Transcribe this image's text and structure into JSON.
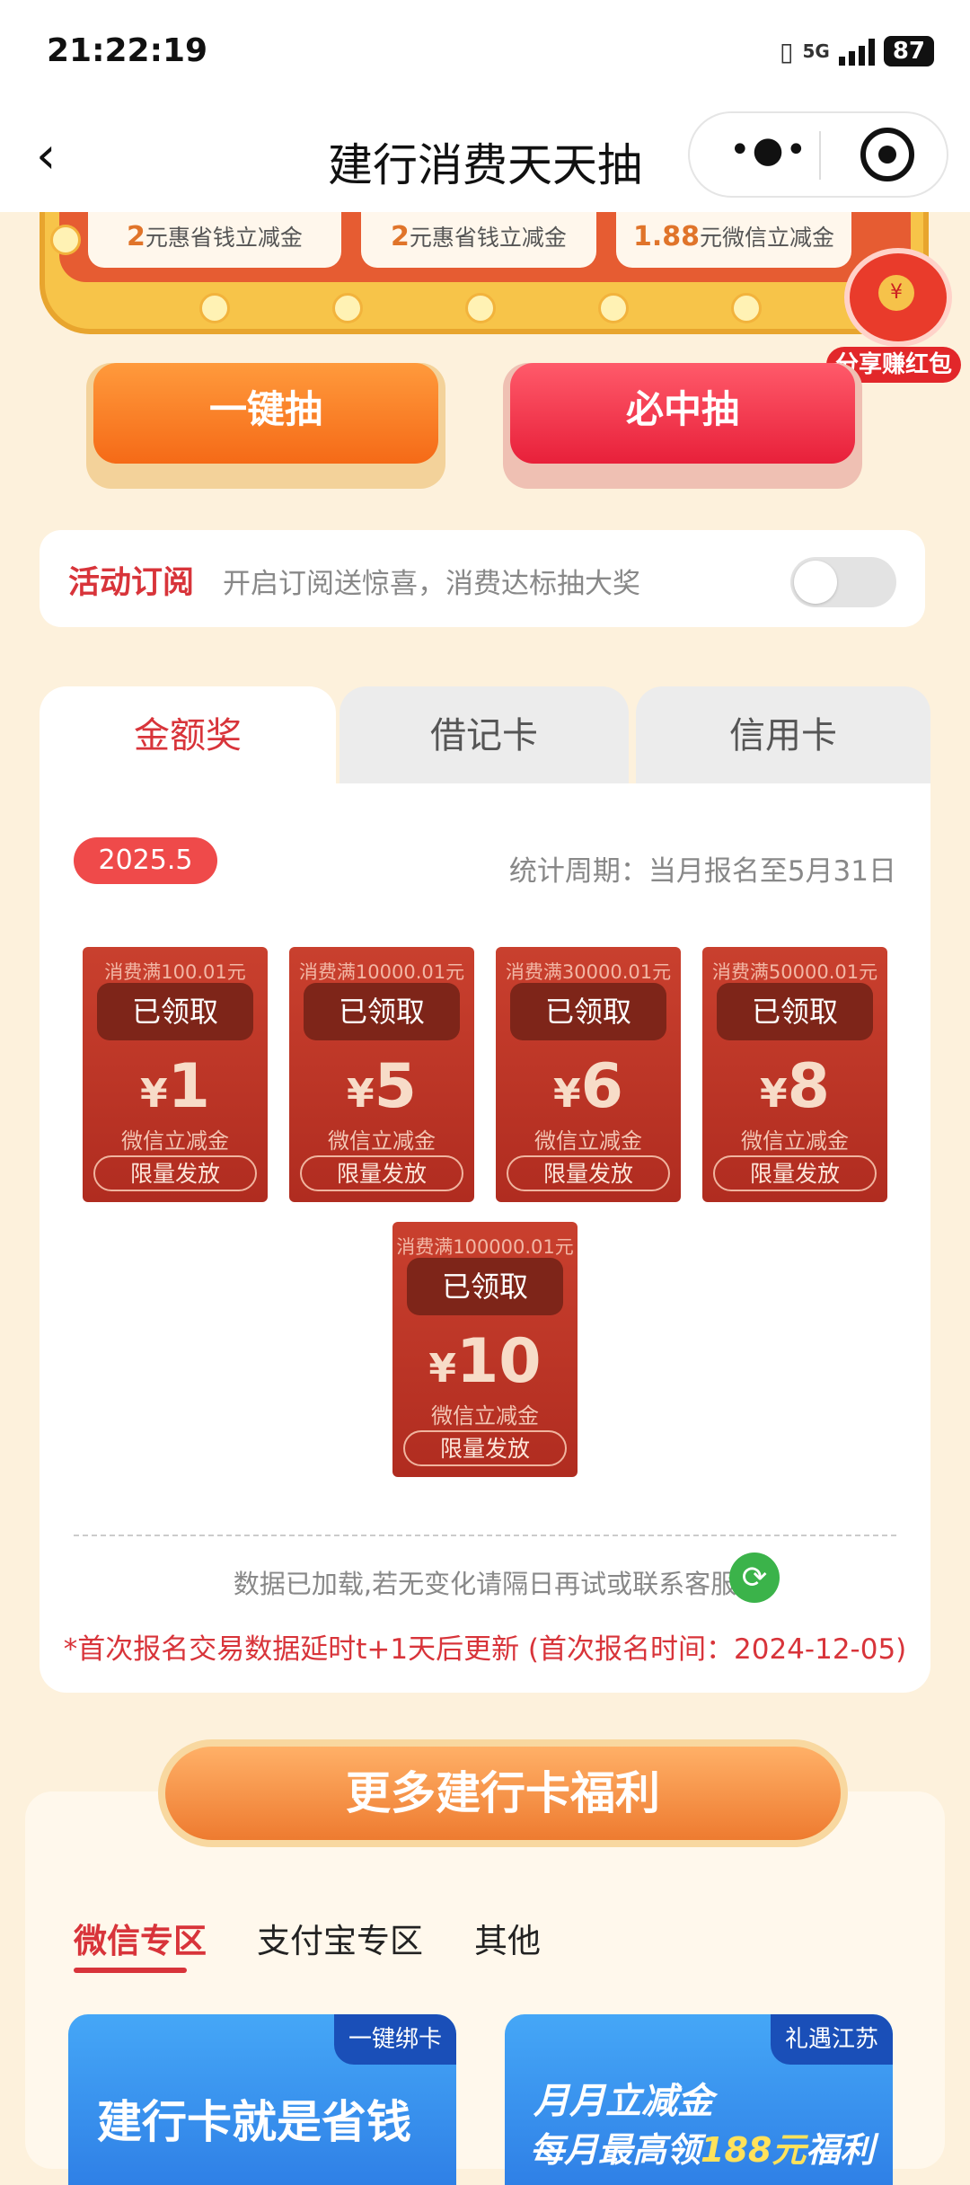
{
  "status_bar": {
    "time": "21:22:19",
    "network": "5G",
    "battery": "87"
  },
  "nav": {
    "back_icon": "chevron-left",
    "title": "建行消费天天抽",
    "more_icon": "ellipsis",
    "close_icon": "target-circle"
  },
  "prize_strip": [
    {
      "amount": "2",
      "label": "元惠省钱立减金"
    },
    {
      "amount": "2",
      "label": "元惠省钱立减金"
    },
    {
      "amount": "1.88",
      "label": "元微信立减金"
    }
  ],
  "share": {
    "label": "分享赚红包",
    "coin": "¥"
  },
  "buttons": {
    "one_click": "一键抽",
    "guaranteed": "必中抽"
  },
  "subscription": {
    "title": "活动订阅",
    "description": "开启订阅送惊喜，消费达标抽大奖",
    "enabled": false
  },
  "tabs": [
    {
      "label": "金额奖",
      "active": true
    },
    {
      "label": "借记卡",
      "active": false
    },
    {
      "label": "信用卡",
      "active": false
    }
  ],
  "period": {
    "badge": "2025.5",
    "text": "统计周期：当月报名至5月31日"
  },
  "coupons": [
    {
      "condition": "消费满100.01元",
      "status": "已领取",
      "currency": "¥",
      "amount": "1",
      "type": "微信立减金",
      "limit": "限量发放"
    },
    {
      "condition": "消费满10000.01元",
      "status": "已领取",
      "currency": "¥",
      "amount": "5",
      "type": "微信立减金",
      "limit": "限量发放"
    },
    {
      "condition": "消费满30000.01元",
      "status": "已领取",
      "currency": "¥",
      "amount": "6",
      "type": "微信立减金",
      "limit": "限量发放"
    },
    {
      "condition": "消费满50000.01元",
      "status": "已领取",
      "currency": "¥",
      "amount": "8",
      "type": "微信立减金",
      "limit": "限量发放"
    },
    {
      "condition": "消费满100000.01元",
      "status": "已领取",
      "currency": "¥",
      "amount": "10",
      "type": "微信立减金",
      "limit": "限量发放"
    }
  ],
  "footer": {
    "loaded_text": "数据已加载,若无变化请隔日再试或联系客服",
    "refresh_icon": "refresh",
    "note": "*首次报名交易数据延时t+1天后更新 (首次报名时间：2024-12-05)"
  },
  "more_benefits": {
    "button": "更多建行卡福利",
    "tabs": [
      "微信专区",
      "支付宝专区",
      "其他"
    ],
    "banners": [
      {
        "tag": "一键绑卡",
        "title": "建行卡就是省钱"
      },
      {
        "tag": "礼遇江苏",
        "title": "月月立减金",
        "subtitle_prefix": "每月最高领",
        "subtitle_highlight": "188元",
        "subtitle_suffix": "福利"
      }
    ]
  },
  "colors": {
    "accent": "#d8343a",
    "coupon": "#b9321f",
    "tab_inactive": "#ececec"
  }
}
